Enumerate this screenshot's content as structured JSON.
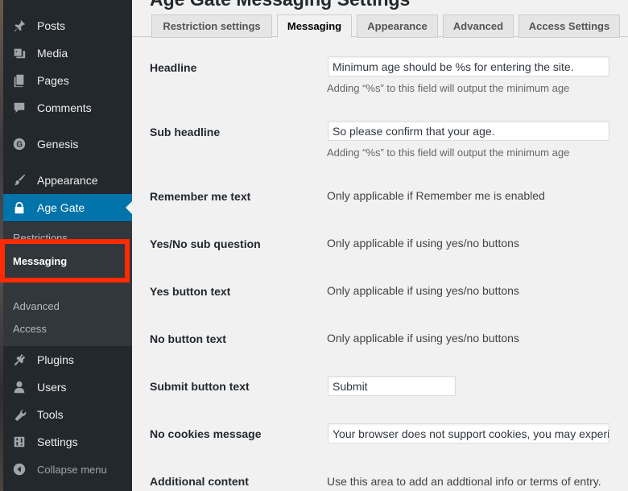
{
  "sidebar": {
    "items": [
      {
        "label": "Posts",
        "icon": "pushpin-icon"
      },
      {
        "label": "Media",
        "icon": "media-icon"
      },
      {
        "label": "Pages",
        "icon": "pages-icon"
      },
      {
        "label": "Comments",
        "icon": "comment-icon"
      },
      {
        "label": "Genesis",
        "icon": "genesis-icon"
      },
      {
        "label": "Appearance",
        "icon": "paintbrush-icon"
      },
      {
        "label": "Age Gate",
        "icon": "lock-icon"
      },
      {
        "label": "Plugins",
        "icon": "plugin-icon"
      },
      {
        "label": "Users",
        "icon": "users-icon"
      },
      {
        "label": "Tools",
        "icon": "wrench-icon"
      },
      {
        "label": "Settings",
        "icon": "settings-icon"
      },
      {
        "label": "Collapse menu",
        "icon": "collapse-icon"
      }
    ],
    "submenu": [
      "Restrictions",
      "Messaging",
      "Advanced",
      "Access"
    ],
    "highlight_color": "#ff2a00",
    "active_color": "#0073aa"
  },
  "page_title": "Age Gate Messaging Settings",
  "tabs": [
    "Restriction settings",
    "Messaging",
    "Appearance",
    "Advanced",
    "Access Settings"
  ],
  "form": {
    "headline": {
      "label": "Headline",
      "value": "Minimum age should be %s for entering the site.",
      "desc": "Adding “%s” to this field will output the minimum age"
    },
    "sub_headline": {
      "label": "Sub headline",
      "value": "So please confirm that your age.",
      "desc": "Adding “%s” to this field will output the minimum age"
    },
    "remember_me": {
      "label": "Remember me text",
      "note": "Only applicable if Remember me is enabled"
    },
    "yes_no_sub": {
      "label": "Yes/No sub question",
      "note": "Only applicable if using yes/no buttons"
    },
    "yes_button": {
      "label": "Yes button text",
      "note": "Only applicable if using yes/no buttons"
    },
    "no_button": {
      "label": "No button text",
      "note": "Only applicable if using yes/no buttons"
    },
    "submit_button": {
      "label": "Submit button text",
      "value": "Submit"
    },
    "no_cookies": {
      "label": "No cookies message",
      "value": "Your browser does not support cookies, you may experience problems entering this site"
    },
    "additional": {
      "label": "Additional content",
      "note": "Use this area to add an addtional info or terms of entry."
    }
  }
}
